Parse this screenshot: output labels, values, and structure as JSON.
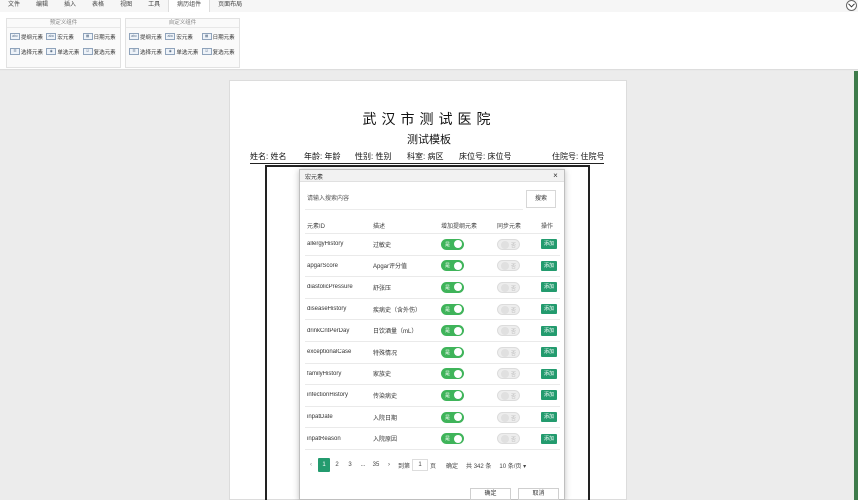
{
  "menu": [
    "文件",
    "编辑",
    "插入",
    "表格",
    "视图",
    "工具",
    "病历组件",
    "页面布局"
  ],
  "ribbon": {
    "group1": {
      "title": "预定义组件",
      "row1": [
        {
          "icon": "text-field-icon",
          "glyph": "abc",
          "label": "提纲元素"
        },
        {
          "icon": "macro-icon",
          "glyph": "abc",
          "label": "宏元素"
        },
        {
          "icon": "calendar-icon",
          "glyph": "▦",
          "label": "日期元素"
        }
      ],
      "row2": [
        {
          "icon": "select-icon",
          "glyph": "☰",
          "label": "选择元素"
        },
        {
          "icon": "radio-icon",
          "glyph": "◉",
          "label": "单选元素"
        },
        {
          "icon": "checkbox-icon",
          "glyph": "☑",
          "label": "复选元素"
        }
      ]
    },
    "group2": {
      "title": "自定义组件",
      "row1": [
        {
          "icon": "text-field-icon",
          "glyph": "abc",
          "label": "提纲元素"
        },
        {
          "icon": "macro-icon",
          "glyph": "abc",
          "label": "宏元素"
        },
        {
          "icon": "calendar-icon",
          "glyph": "▦",
          "label": "日期元素"
        }
      ],
      "row2": [
        {
          "icon": "select-icon",
          "glyph": "☰",
          "label": "选择元素"
        },
        {
          "icon": "radio-icon",
          "glyph": "◉",
          "label": "单选元素"
        },
        {
          "icon": "checkbox-icon",
          "glyph": "☑",
          "label": "复选元素"
        }
      ]
    }
  },
  "document": {
    "title": "武汉市测试医院",
    "subtitle": "测试模板",
    "fields": {
      "name": "姓名: 姓名",
      "age": "年龄: 年龄",
      "gender": "性别: 性别",
      "dept": "科室: 病区",
      "bed": "床位号: 床位号",
      "admission": "住院号: 住院号"
    }
  },
  "dialog": {
    "title": "宏元素",
    "close": "×",
    "search_placeholder": "请输入搜索内容",
    "search_button": "搜索",
    "columns": [
      "元素ID",
      "描述",
      "增加提纲元素",
      "同步元素",
      "操作"
    ],
    "rows": [
      {
        "id": "allergyHistory",
        "desc": "过敏史",
        "add_outline": true,
        "sync": false,
        "action": "添加"
      },
      {
        "id": "apgarScore",
        "desc": "Apgar评分值",
        "add_outline": true,
        "sync": false,
        "action": "添加"
      },
      {
        "id": "diastolicPressure",
        "desc": "舒张压",
        "add_outline": true,
        "sync": false,
        "action": "添加"
      },
      {
        "id": "diseaseHistory",
        "desc": "疾病史（含外伤）",
        "add_outline": true,
        "sync": false,
        "action": "添加"
      },
      {
        "id": "drinkCntPerDay",
        "desc": "日饮酒量（mL）",
        "add_outline": true,
        "sync": false,
        "action": "添加"
      },
      {
        "id": "exceptionalCase",
        "desc": "特殊情况",
        "add_outline": true,
        "sync": false,
        "action": "添加"
      },
      {
        "id": "familyHistory",
        "desc": "家族史",
        "add_outline": true,
        "sync": false,
        "action": "添加"
      },
      {
        "id": "infectionHistory",
        "desc": "传染病史",
        "add_outline": true,
        "sync": false,
        "action": "添加"
      },
      {
        "id": "inpatDate",
        "desc": "入院日期",
        "add_outline": true,
        "sync": false,
        "action": "添加"
      },
      {
        "id": "inpatReason",
        "desc": "入院原因",
        "add_outline": true,
        "sync": false,
        "action": "添加"
      }
    ],
    "toggle_on_label": "是",
    "toggle_off_label": "否",
    "pager": {
      "prev": "‹",
      "pages": [
        "1",
        "2",
        "3"
      ],
      "ellipsis": "...",
      "last": "35",
      "next": "›",
      "goto_label": "到第",
      "goto_value": "1",
      "page_unit": "页",
      "confirm": "确定",
      "total": "共 342 条",
      "page_size": "10 条/页"
    },
    "ok": "确定",
    "cancel": "取消"
  }
}
